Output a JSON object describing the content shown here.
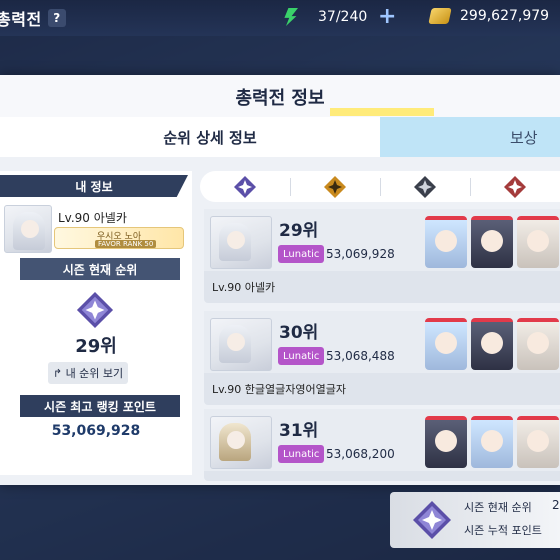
{
  "hud": {
    "title": "총력전",
    "help": "?",
    "stamina": "37/240",
    "plus": "+",
    "gold": "299,627,979"
  },
  "modal": {
    "title": "총력전 정보",
    "tabs": [
      {
        "label": "순위 상세 정보",
        "active": true
      },
      {
        "label": "보상",
        "active": false
      }
    ]
  },
  "my_info": {
    "header": "내 정보",
    "level": "Lv.90 아넬카",
    "favor_name": "우시오 노아",
    "favor_rank": "FAVOR RANK 50",
    "season_rank_label": "시즌 현재 순위",
    "rank": "29위",
    "my_rank_button": "내 순위 보기",
    "best_point_label": "시즌 최고 랭킹 포인트",
    "best_point": "53,069,928"
  },
  "tiers": [
    {
      "name": "tier-purple",
      "color": "#5b4fa8"
    },
    {
      "name": "tier-gold",
      "color": "#c98a1e"
    },
    {
      "name": "tier-black",
      "color": "#3a3f4b"
    },
    {
      "name": "tier-red",
      "color": "#a43b3b"
    }
  ],
  "ranking": [
    {
      "rank": "29위",
      "difficulty": "Lunatic",
      "points": "53,069,928",
      "name": "Lv.90 아넬카",
      "avatar": "white",
      "team": [
        "blue",
        "dark",
        "pale"
      ]
    },
    {
      "rank": "30위",
      "difficulty": "Lunatic",
      "points": "53,068,488",
      "name": "Lv.90 한글열글자영어열글자",
      "avatar": "white",
      "team": [
        "blue",
        "dark",
        "pale"
      ]
    },
    {
      "rank": "31위",
      "difficulty": "Lunatic",
      "points": "53,068,200",
      "name": "",
      "avatar": "hat",
      "team": [
        "dark",
        "blue",
        "pale"
      ]
    }
  ],
  "bottom": {
    "season_rank_label": "시즌 현재 순위",
    "season_rank_value": "2",
    "season_total_label": "시즌 누적 포인트"
  },
  "colors": {
    "accent_yellow": "#ffe96b",
    "lunatic": "#b455c9",
    "navy": "#2f3e5d"
  }
}
